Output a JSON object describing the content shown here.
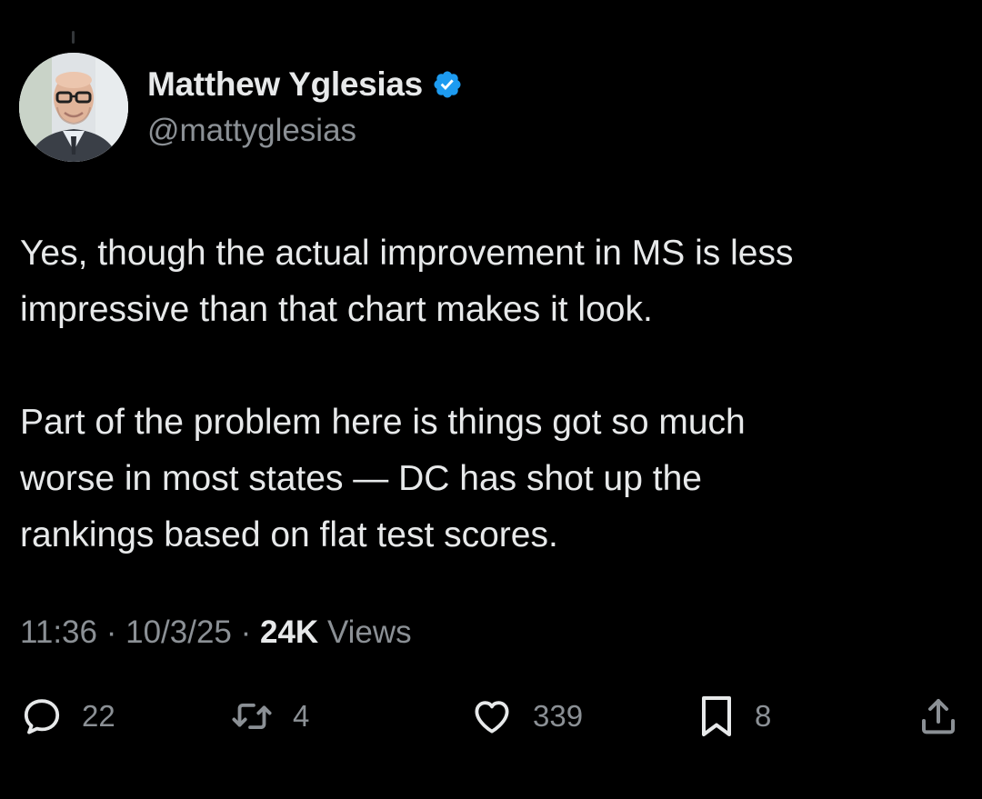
{
  "author": {
    "display_name": "Matthew Yglesias",
    "handle": "@mattyglesias",
    "verified_color": "#1d9bf0"
  },
  "tweet": {
    "paragraphs": [
      "Yes, though the actual improvement in MS is less\nimpressive than that chart makes it look.",
      "Part of the problem here is things got so much\nworse in most states — DC has shot up the\nrankings based on flat test scores."
    ]
  },
  "meta": {
    "time": "11:36",
    "separator": " · ",
    "date": "10/3/25",
    "views_count": "24K",
    "views_label": " Views"
  },
  "actions": {
    "replies": "22",
    "retweets": "4",
    "likes": "339",
    "bookmarks": "8"
  },
  "icons": {
    "reply": "reply-icon",
    "retweet": "retweet-icon",
    "like": "heart-icon",
    "bookmark": "bookmark-icon",
    "share": "share-icon",
    "verified": "verified-badge-icon"
  },
  "colors": {
    "background": "#000000",
    "text_primary": "#e7e9ea",
    "text_secondary": "#8b9095",
    "accent": "#1d9bf0"
  }
}
